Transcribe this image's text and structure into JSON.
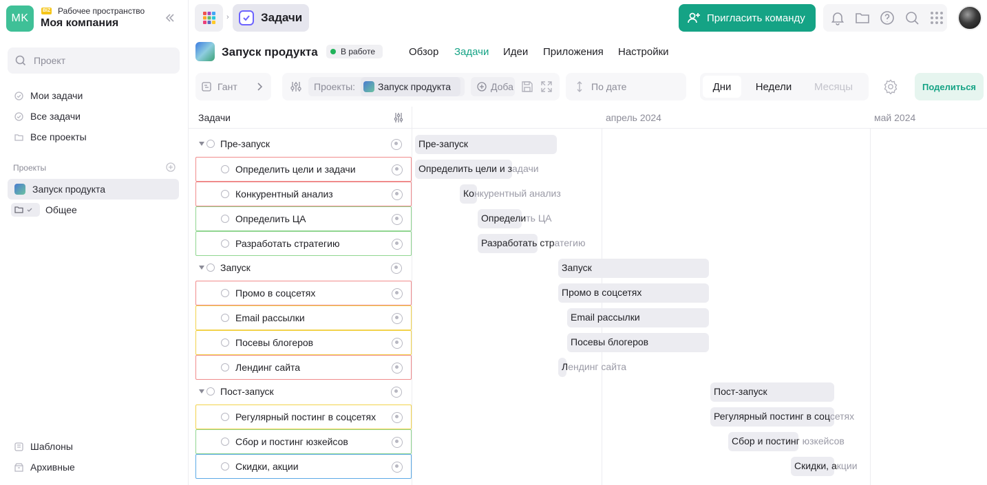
{
  "workspace": {
    "initials": "MK",
    "badge": "BIZ",
    "label": "Рабочее пространство",
    "name": "Моя компания"
  },
  "sidebar": {
    "search_placeholder": "Проект",
    "nav": [
      {
        "label": "Мои задачи",
        "icon": "check-circle-icon"
      },
      {
        "label": "Все задачи",
        "icon": "check-circle-icon"
      },
      {
        "label": "Все проекты",
        "icon": "folder-icon"
      }
    ],
    "projects_title": "Проекты",
    "projects": [
      {
        "label": "Запуск продукта",
        "active": true
      },
      {
        "label": "Общее",
        "active": false
      }
    ],
    "bottom": [
      {
        "label": "Шаблоны",
        "icon": "template-icon"
      },
      {
        "label": "Архивные",
        "icon": "archive-icon"
      }
    ]
  },
  "topbar": {
    "section": "Задачи",
    "invite_label": "Пригласить команду"
  },
  "project": {
    "title": "Запуск продукта",
    "status": "В работе",
    "tabs": [
      "Обзор",
      "Задачи",
      "Идеи",
      "Приложения",
      "Настройки"
    ],
    "active_tab": "Задачи"
  },
  "toolbar": {
    "view": "Гант",
    "projects_label": "Проекты:",
    "project_chip": "Запуск продукта",
    "add_label": "Доба",
    "sort_label": "По дате",
    "scales": [
      "Дни",
      "Недели",
      "Месяцы"
    ],
    "share_label": "Поделиться"
  },
  "gantt": {
    "column_title": "Задачи",
    "months": [
      "апрель 2024",
      "май 2024"
    ],
    "rows": [
      {
        "label": "Пре-запуск",
        "group": true,
        "border": ""
      },
      {
        "label": "Определить цели и задачи",
        "group": false,
        "border": "#f08b8b"
      },
      {
        "label": "Конкурентный анализ",
        "group": false,
        "border": "#f08b8b"
      },
      {
        "label": "Определить ЦА",
        "group": false,
        "border": "#8fd58f"
      },
      {
        "label": "Разработать стратегию",
        "group": false,
        "border": "#8fd58f"
      },
      {
        "label": "Запуск",
        "group": true,
        "border": ""
      },
      {
        "label": "Промо в соцсетях",
        "group": false,
        "border": "#f08b8b"
      },
      {
        "label": "Email рассылки",
        "group": false,
        "border": "#f2d24a"
      },
      {
        "label": "Посевы блогеров",
        "group": false,
        "border": "#f2d24a"
      },
      {
        "label": "Лендинг сайта",
        "group": false,
        "border": "#f08b8b"
      },
      {
        "label": "Пост-запуск",
        "group": true,
        "border": ""
      },
      {
        "label": "Регулярный постинг в соцсетях",
        "group": false,
        "border": "#f2d24a"
      },
      {
        "label": "Сбор и постинг юзкейсов",
        "group": false,
        "border": "#8fd58f"
      },
      {
        "label": "Скидки, акции",
        "group": false,
        "border": "#5aa9e6"
      }
    ],
    "bars": [
      {
        "in": "Пре-запуск",
        "out": ""
      },
      {
        "in": "Определить цели и з",
        "out": "адачи"
      },
      {
        "in": "Ко",
        "out": "нкурентный анализ"
      },
      {
        "in": "Определи",
        "out": "ть ЦА"
      },
      {
        "in": "Разработать стр",
        "out": "атегию"
      },
      {
        "in": "Запуск",
        "out": ""
      },
      {
        "in": "Промо в соцсетях",
        "out": ""
      },
      {
        "in": "Email рассылки",
        "out": ""
      },
      {
        "in": "Посевы блогеров",
        "out": ""
      },
      {
        "in": "Л",
        "out": "ендинг сайта"
      },
      {
        "in": "Пост-запуск",
        "out": ""
      },
      {
        "in": "Регулярный постинг в соц",
        "out": "сетях"
      },
      {
        "in": "Сбор и постинг",
        "out": " юзкейсов"
      },
      {
        "in": "Скидки, а",
        "out": "кции"
      }
    ]
  },
  "colors": {
    "accent": "#15a385",
    "status_green": "#21b35a",
    "border_red": "#f08b8b",
    "border_yellow": "#f2d24a",
    "border_green": "#8fd58f",
    "border_blue": "#5aa9e6"
  }
}
